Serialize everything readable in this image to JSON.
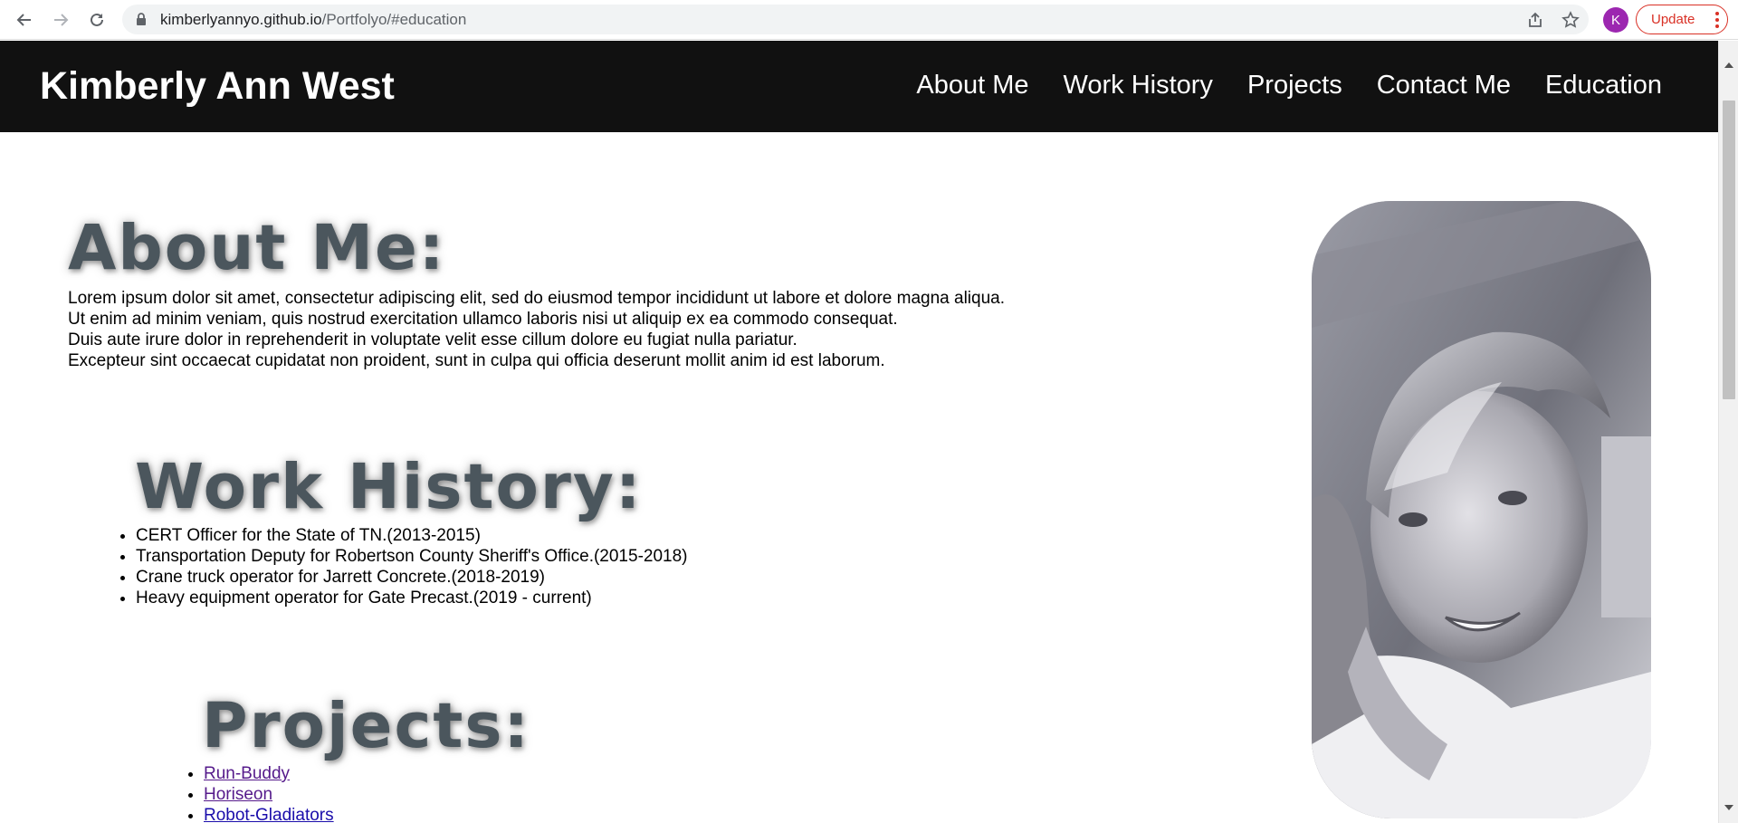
{
  "browser": {
    "url_host": "kimberlyannyo.github.io",
    "url_path": "/Portfolyo/#education",
    "profile_initial": "K",
    "update_label": "Update"
  },
  "site": {
    "title": "Kimberly Ann West",
    "nav": [
      "About Me",
      "Work History",
      "Projects",
      "Contact Me",
      "Education"
    ]
  },
  "about": {
    "heading": "About Me:",
    "lines": [
      "Lorem ipsum dolor sit amet, consectetur adipiscing elit, sed do eiusmod tempor incididunt ut labore et dolore magna aliqua.",
      "Ut enim ad minim veniam, quis nostrud exercitation ullamco laboris nisi ut aliquip ex ea commodo consequat.",
      "Duis aute irure dolor in reprehenderit in voluptate velit esse cillum dolore eu fugiat nulla pariatur.",
      "Excepteur sint occaecat cupidatat non proident, sunt in culpa qui officia deserunt mollit anim id est laborum."
    ]
  },
  "work": {
    "heading": "Work History:",
    "items": [
      "CERT Officer for the State of TN.(2013-2015)",
      "Transportation Deputy for Robertson County Sheriff's Office.(2015-2018)",
      "Crane truck operator for Jarrett Concrete.(2018-2019)",
      "Heavy equipment operator for Gate Precast.(2019 - current)"
    ]
  },
  "projects": {
    "heading": "Projects:",
    "items": [
      "Run-Buddy",
      "Horiseon",
      "Robot-Gladiators"
    ]
  }
}
